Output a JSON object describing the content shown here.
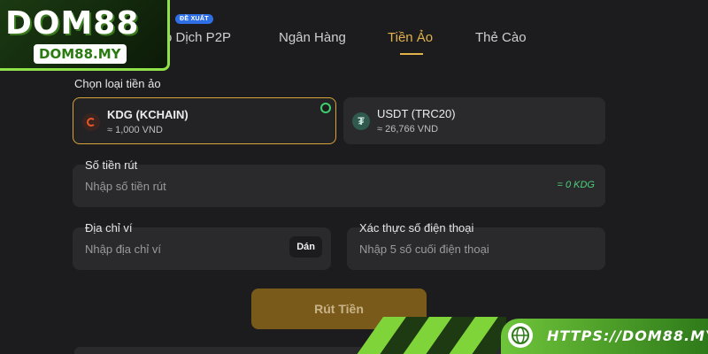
{
  "logo": {
    "main": "DOM88",
    "sub": "DOM88.MY"
  },
  "tabs": {
    "badge": "ĐỀ XUẤT",
    "items": [
      {
        "label": "o Dịch P2P"
      },
      {
        "label": "Ngân Hàng"
      },
      {
        "label": "Tiền Ảo"
      },
      {
        "label": "Thẻ Cào"
      }
    ]
  },
  "crypto": {
    "section_label": "Chọn loại tiền ảo",
    "options": [
      {
        "name": "KDG (KCHAIN)",
        "rate": "≈ 1,000 VND",
        "icon": "kdg-coin-icon",
        "selected": true
      },
      {
        "name": "USDT (TRC20)",
        "rate": "≈ 26,766 VND",
        "icon": "usdt-coin-icon",
        "icon_glyph": "₮",
        "selected": false
      }
    ]
  },
  "amount": {
    "label": "Số tiền rút",
    "placeholder": "Nhập số tiền rút",
    "conversion": "= 0 KDG"
  },
  "wallet": {
    "label": "Địa chỉ ví",
    "placeholder": "Nhập địa chỉ ví",
    "paste_label": "Dán"
  },
  "phone": {
    "label": "Xác thực số điện thoại",
    "placeholder": "Nhập 5 số cuối điện thoại"
  },
  "submit": {
    "label": "Rút Tiền"
  },
  "banner": {
    "url": "HTTPS://DOM88.MY"
  },
  "colors": {
    "accent": "#e0b24a",
    "success": "#4cd07a",
    "brand_green": "#7fd43a"
  }
}
